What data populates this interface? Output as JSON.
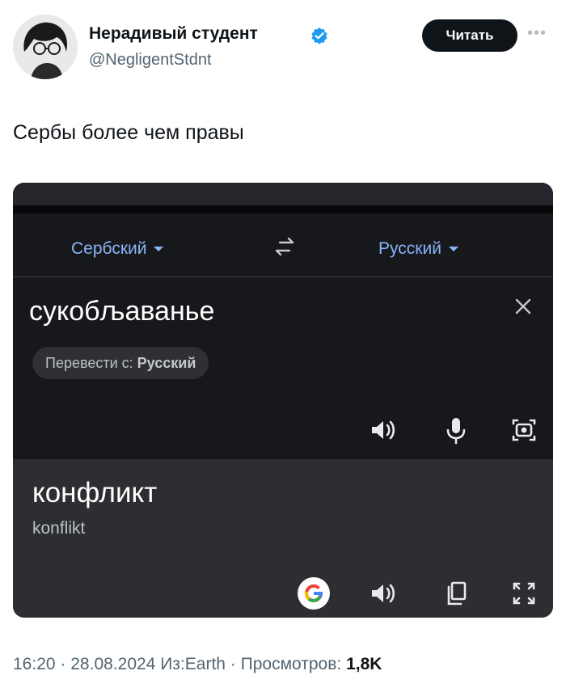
{
  "author": {
    "name": "Нерадивый студент",
    "handle": "@NegligentStdnt",
    "verified_color": "#1d9bf0"
  },
  "actions": {
    "follow_label": "Читать",
    "more_label": "•••"
  },
  "tweet": {
    "text": "Сербы более чем правы"
  },
  "translator": {
    "source_lang": "Сербский",
    "target_lang": "Русский",
    "source_text": "сукобљаванье",
    "detect_prefix": "Перевести с:",
    "detect_lang": "Русский",
    "result_text": "конфликт",
    "transliteration": "konflikt",
    "accent_color": "#8ab4f8",
    "icons": [
      "swap-languages-icon",
      "close-icon",
      "speaker-icon",
      "microphone-icon",
      "camera-icon",
      "google-logo-icon",
      "copy-icon",
      "expand-icon"
    ]
  },
  "meta": {
    "time": "16:20",
    "date": "28.08.2024",
    "source": "Из:Earth",
    "views_label": "Просмотров:",
    "views_count": "1,8K",
    "sep": "·"
  }
}
